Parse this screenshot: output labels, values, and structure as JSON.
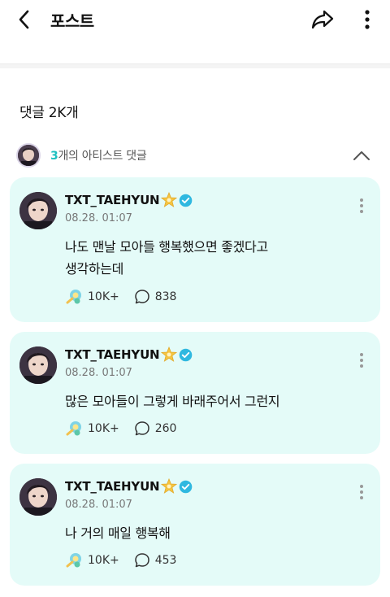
{
  "header": {
    "title": "포스트",
    "back_icon": "chevron-left-icon",
    "share_icon": "share-arrow-icon",
    "more_icon": "vertical-dots-icon"
  },
  "comments_section": {
    "count_label": "댓글 2K개",
    "artist_row": {
      "count": "3",
      "label": "개의 아티스트 댓글",
      "toggle_icon": "chevron-up-icon"
    }
  },
  "theme": {
    "card_bg": "#e4fbf8",
    "accent": "#1fc0c0",
    "verified": "#2fb8e0"
  },
  "comments": [
    {
      "author": "TXT_TAEHYUN",
      "date": "08.28. 01:07",
      "text": "나도 맨날 모아들 행복했으면 좋겠다고\n생각하는데",
      "likes": "10K+",
      "replies": "838"
    },
    {
      "author": "TXT_TAEHYUN",
      "date": "08.28. 01:07",
      "text": "많은 모아들이 그렇게 바래주어서 그런지",
      "likes": "10K+",
      "replies": "260"
    },
    {
      "author": "TXT_TAEHYUN",
      "date": "08.28. 01:07",
      "text": "나 거의 매일 행복해",
      "likes": "10K+",
      "replies": "453"
    }
  ]
}
